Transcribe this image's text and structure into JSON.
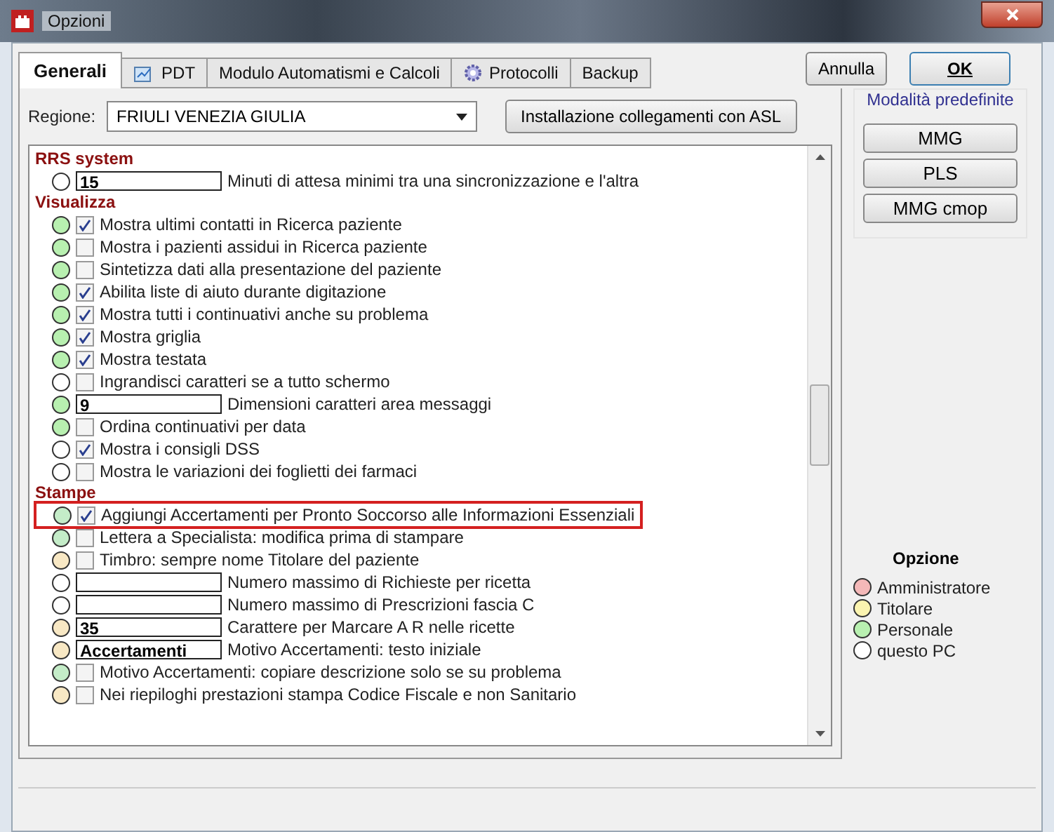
{
  "window": {
    "title": "Opzioni"
  },
  "tabs": [
    {
      "label": "Generali",
      "selected": true
    },
    {
      "label": "PDT",
      "selected": false
    },
    {
      "label": "Modulo Automatismi e Calcoli",
      "selected": false
    },
    {
      "label": "Protocolli",
      "selected": false
    },
    {
      "label": "Backup",
      "selected": false
    }
  ],
  "dialog_buttons": [
    {
      "label": "Annulla",
      "default": false
    },
    {
      "label": "OK",
      "default": true
    }
  ],
  "region": {
    "label": "Regione:",
    "value": "FRIULI VENEZIA GIULIA"
  },
  "asl_button": "Installazione collegamenti con ASL",
  "options": [
    {
      "kind": "header",
      "title": "RRS system"
    },
    {
      "kind": "field",
      "color": "#ffffff",
      "field": {
        "value": "15"
      },
      "label": "Minuti di attesa minimi tra una sincronizzazione e l'altra",
      "highlighted": false
    },
    {
      "kind": "header",
      "title": "Visualizza"
    },
    {
      "kind": "check",
      "color": "#b8f0b0",
      "checked": true,
      "label": "Mostra ultimi contatti in Ricerca paziente",
      "highlighted": false
    },
    {
      "kind": "check",
      "color": "#b8f0b0",
      "checked": false,
      "label": "Mostra i pazienti assidui in Ricerca paziente",
      "highlighted": false
    },
    {
      "kind": "check",
      "color": "#b8f0b0",
      "checked": false,
      "label": "Sintetizza dati alla presentazione del paziente",
      "highlighted": false
    },
    {
      "kind": "check",
      "color": "#b8f0b0",
      "checked": true,
      "label": "Abilita liste di aiuto durante digitazione",
      "highlighted": false
    },
    {
      "kind": "check",
      "color": "#b8f0b0",
      "checked": true,
      "label": "Mostra tutti i continuativi anche su problema",
      "highlighted": false
    },
    {
      "kind": "check",
      "color": "#b8f0b0",
      "checked": true,
      "label": "Mostra griglia",
      "highlighted": false
    },
    {
      "kind": "check",
      "color": "#b8f0b0",
      "checked": true,
      "label": "Mostra testata",
      "highlighted": false
    },
    {
      "kind": "check",
      "color": "#ffffff",
      "checked": false,
      "label": "Ingrandisci caratteri se a tutto schermo",
      "highlighted": false
    },
    {
      "kind": "field",
      "color": "#b8f0b0",
      "field": {
        "value": "9"
      },
      "label": "Dimensioni caratteri area messaggi",
      "highlighted": false
    },
    {
      "kind": "check",
      "color": "#b8f0b0",
      "checked": false,
      "label": "Ordina continuativi per data",
      "highlighted": false
    },
    {
      "kind": "check",
      "color": "#ffffff",
      "checked": true,
      "label": "Mostra i consigli DSS",
      "highlighted": false
    },
    {
      "kind": "check",
      "color": "#ffffff",
      "checked": false,
      "label": "Mostra le variazioni dei foglietti dei farmaci",
      "highlighted": false
    },
    {
      "kind": "header",
      "title": "Stampe"
    },
    {
      "kind": "check",
      "color": "#c4ecc8",
      "checked": true,
      "label": "Aggiungi Accertamenti per Pronto Soccorso alle Informazioni Essenziali",
      "highlighted": true
    },
    {
      "kind": "check",
      "color": "#c4ecc8",
      "checked": false,
      "label": "Lettera a Specialista: modifica prima di stampare",
      "highlighted": false
    },
    {
      "kind": "check",
      "color": "#f8e8c4",
      "checked": false,
      "label": "Timbro: sempre nome Titolare del paziente",
      "highlighted": false
    },
    {
      "kind": "field",
      "color": "#ffffff",
      "label": "Numero massimo di Richieste per ricetta",
      "highlighted": false
    },
    {
      "kind": "field",
      "color": "#ffffff",
      "label": "Numero massimo di Prescrizioni fascia C",
      "highlighted": false
    },
    {
      "kind": "field",
      "color": "#f8e8c4",
      "field": {
        "value": "35"
      },
      "label": "Carattere per Marcare A R nelle ricette",
      "highlighted": false
    },
    {
      "kind": "field",
      "color": "#f8e8c4",
      "field": {
        "value": "Accertamenti"
      },
      "label": "Motivo Accertamenti: testo iniziale",
      "highlighted": false
    },
    {
      "kind": "check",
      "color": "#c4ecc8",
      "checked": false,
      "label": "Motivo Accertamenti: copiare descrizione solo se su problema",
      "highlighted": false
    },
    {
      "kind": "check",
      "color": "#f8e8c4",
      "checked": false,
      "label": "Nei riepiloghi prestazioni stampa Codice Fiscale e non Sanitario",
      "highlighted": false
    }
  ],
  "presets": {
    "title": "Modalità predefinite",
    "buttons": [
      "MMG",
      "PLS",
      "MMG cmop"
    ]
  },
  "legend": {
    "title": "Opzione",
    "items": [
      {
        "label": "Amministratore",
        "color": "#f4b8b8"
      },
      {
        "label": "Titolare",
        "color": "#fbf4b0"
      },
      {
        "label": "Personale",
        "color": "#b8f0b0"
      },
      {
        "label": "questo PC",
        "color": "#ffffff"
      }
    ]
  }
}
